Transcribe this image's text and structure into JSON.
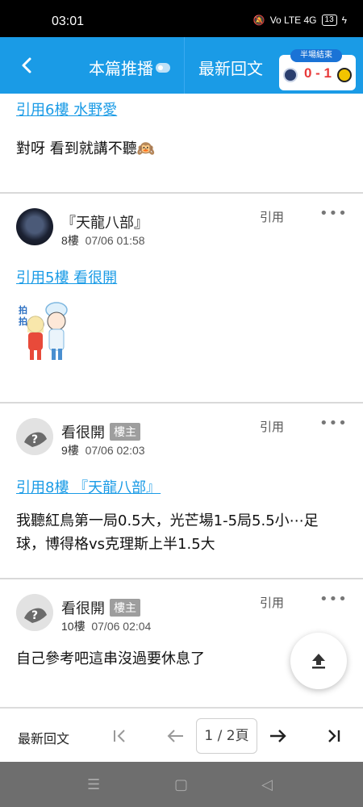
{
  "status": {
    "time": "03:01",
    "signal_text": "Vo LTE 4G",
    "battery": "13"
  },
  "header": {
    "tab_push": "本篇推播",
    "tab_latest": "最新回文",
    "score_tag": "半場結束",
    "score": "0 - 1"
  },
  "posts": {
    "p0": {
      "quote": "引用6樓 水野愛",
      "text": "對呀 看到就講不聽🙉"
    },
    "p8": {
      "username": "『天龍八部』",
      "floor": "8樓",
      "time": "07/06 01:58",
      "quote_btn": "引用",
      "more": "•••",
      "quote": "引用5樓 看很開",
      "sticker_text": "拍拍"
    },
    "p9": {
      "username": "看很開",
      "badge": "樓主",
      "floor": "9樓",
      "time": "07/06 02:03",
      "quote_btn": "引用",
      "more": "•••",
      "quote": "引用8樓 『天龍八部』",
      "text": "我聽紅鳥第一局0.5大，光芒場1-5局5.5小⋯足球，博得格vs克理斯上半1.5大"
    },
    "p10": {
      "username": "看很開",
      "badge": "樓主",
      "floor": "10樓",
      "time": "07/06 02:04",
      "quote_btn": "引用",
      "more": "•••",
      "text": "自己參考吧這串沒過要休息了"
    }
  },
  "bottom": {
    "latest_label": "最新回文",
    "page": "1 / 2頁"
  },
  "icons": {
    "back": "chevron-left-icon",
    "upload": "upload-icon",
    "first": "first-page-icon",
    "prev": "arrow-left-icon",
    "next": "arrow-right-icon",
    "last": "last-page-icon"
  },
  "colors": {
    "brand": "#1a9be6",
    "score": "#e83a3a"
  }
}
